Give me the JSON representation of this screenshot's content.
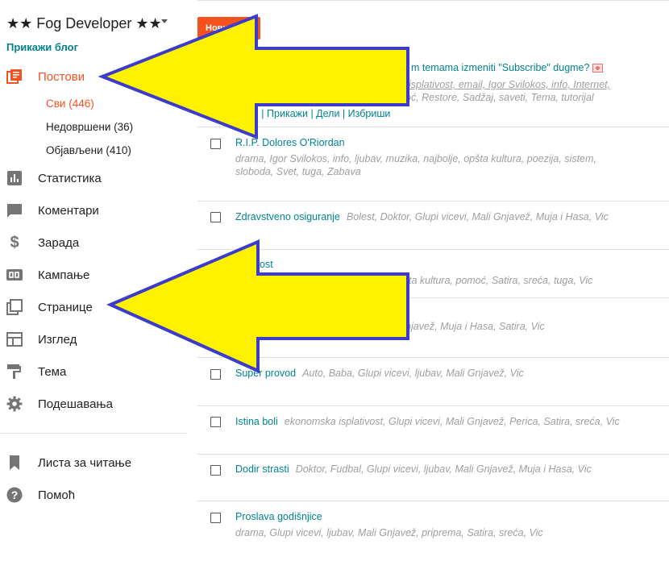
{
  "header": {
    "blog_title": "★★ Fog Developer ★★",
    "view_blog": "Прикажи блог",
    "new_post": "Нови"
  },
  "sidebar": {
    "items": [
      {
        "id": "posts",
        "label": "Постови",
        "icon": "posts-icon"
      },
      {
        "id": "stats",
        "label": "Статистика",
        "icon": "bar-chart-icon"
      },
      {
        "id": "comments",
        "label": "Коментари",
        "icon": "comment-icon"
      },
      {
        "id": "earnings",
        "label": "Зарада",
        "icon": "dollar-icon"
      },
      {
        "id": "campaigns",
        "label": "Кампање",
        "icon": "ad-icon"
      },
      {
        "id": "pages",
        "label": "Странице",
        "icon": "pages-icon"
      },
      {
        "id": "layout",
        "label": "Изглед",
        "icon": "layout-icon"
      },
      {
        "id": "theme",
        "label": "Тема",
        "icon": "paint-roller-icon"
      },
      {
        "id": "settings",
        "label": "Подешавања",
        "icon": "gear-icon"
      }
    ],
    "sub_items": [
      {
        "label": "Сви (446)"
      },
      {
        "label": "Недовршени (36)"
      },
      {
        "label": "Објављени (410)"
      }
    ],
    "bottom_items": [
      {
        "label": "Листа за читање",
        "icon": "bookmark-icon"
      },
      {
        "label": "Помоћ",
        "icon": "help-icon"
      }
    ]
  },
  "posts": [
    {
      "title": "m temama izmeniti \"Subscribe\" dugme?",
      "labels_line1": "isplativost, email, Igor Svilokos, info, Internet,",
      "labels_line2": "oć, Restore, Sadžaj, saveti, Tema, tutorijal",
      "actions": "ени | Прикажи | Дели | Избриши"
    },
    {
      "title": "R.I.P. Dolores O'Riordan",
      "labels_line1": "drama, Igor Svilokos, info, ljubav, muzika, najbolje, opšta kultura, poezija, sistem,",
      "labels_line2": "sloboda, Svet, tuga, Zabava"
    },
    {
      "title": "Zdravstveno osiguranje",
      "labels": "Bolest, Doktor, Glupi vicevi, Mali Gnjavež, Muja i Hasa, Vic"
    },
    {
      "title": "ost",
      "labels_line1": "ta kultura, pomoć, Satira, sreća, tuga, Vic"
    },
    {
      "labels": "njavež, Muja i Hasa, Satira, Vic"
    },
    {
      "title": "Super provod",
      "labels": "Auto, Baba, Glupi vicevi, ljubav, Mali Gnjavež, Vic"
    },
    {
      "title": "Istina boli",
      "labels": "ekonomska isplativost, Glupi vicevi, Mali Gnjavež, Perica, Satira, sreća, Vic"
    },
    {
      "title": "Dodir strasti",
      "labels": "Doktor, Fudbal, Glupi vicevi, ljubav, Mali Gnjavež, Muja i Hasa, Vic"
    },
    {
      "title": "Proslava godišnjice",
      "labels_line1": "drama, Glupi vicevi, ljubav, Mali Gnjavež, priprema, Satira, sreća, Vic"
    }
  ],
  "colors": {
    "accent": "#f4511e",
    "link": "#00838f",
    "arrow_fill": "#fff200",
    "arrow_stroke": "#3c3ccc"
  }
}
